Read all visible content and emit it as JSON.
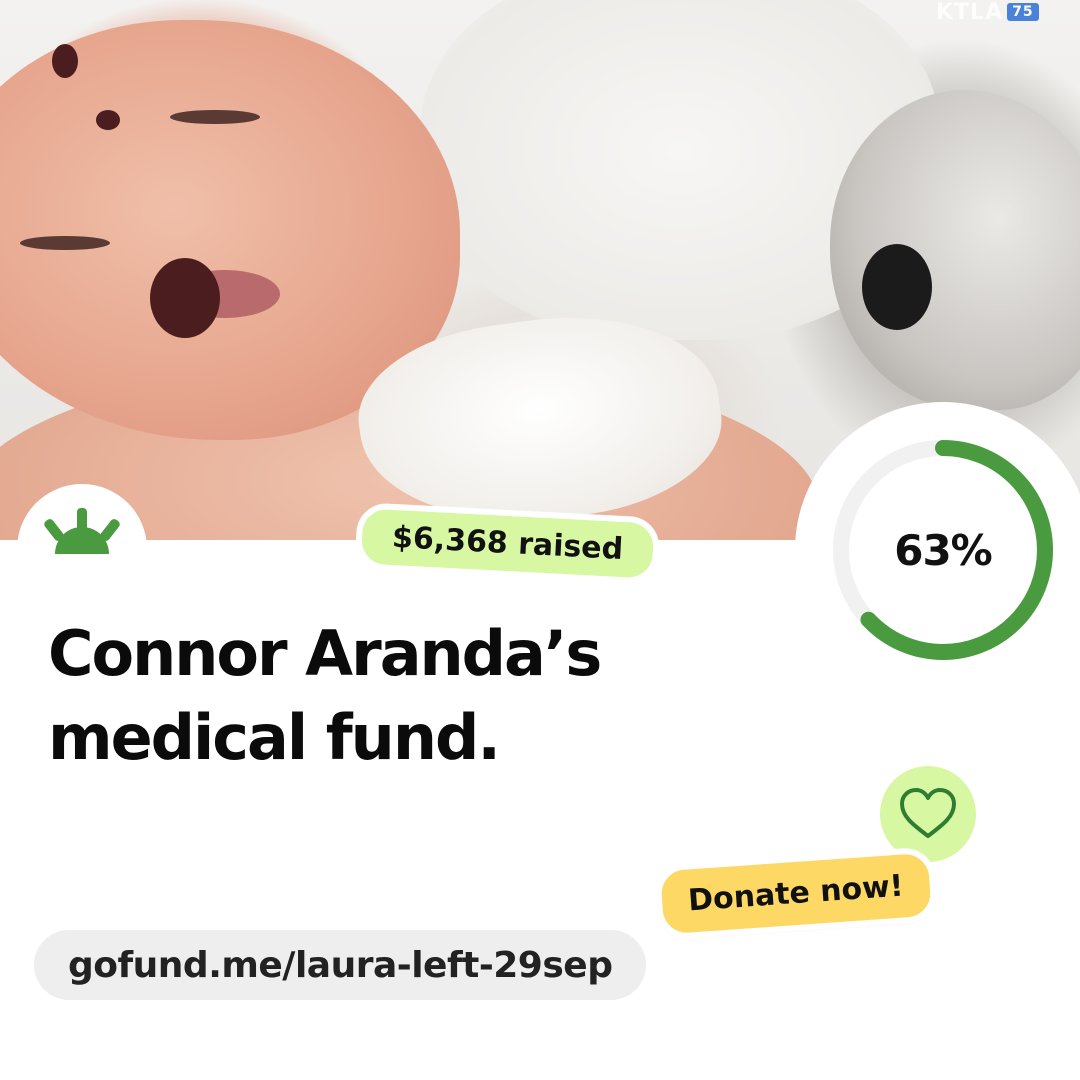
{
  "campaign": {
    "title": "Connor Aranda’s medical fund.",
    "raised_label": "$6,368 raised",
    "progress_label": "63%",
    "progress_fraction": 0.63,
    "donate_label": "Donate now!",
    "url": "gofund.me/laura-left-29sep"
  },
  "photo": {
    "watermark_text": "KTLA",
    "watermark_badge": "75"
  },
  "icons": {
    "logo": "gofundme-sunrise-logo-icon",
    "heart": "heart-icon"
  },
  "colors": {
    "brand_green": "#4a9a3f",
    "raised_pill": "#d8f7a3",
    "donate_button": "#fdd864",
    "url_pill": "#eeeeee",
    "progress_track": "#f1f1f1"
  }
}
